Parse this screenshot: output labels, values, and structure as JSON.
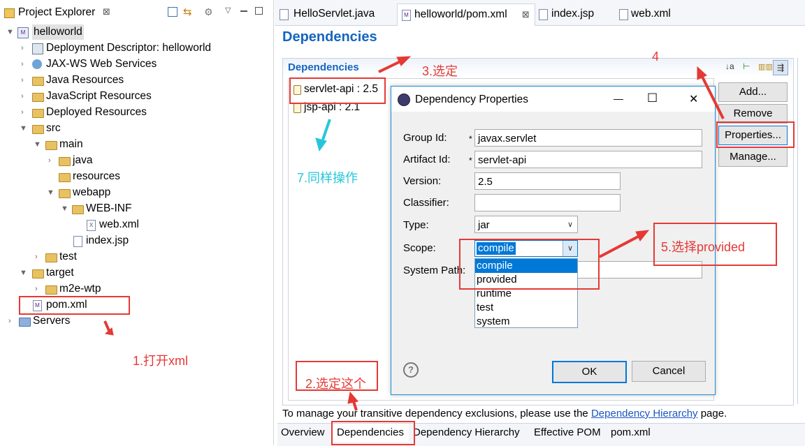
{
  "explorer": {
    "title": "Project Explorer",
    "close_glyph": "⊠",
    "items": [
      {
        "label": "helloworld"
      },
      {
        "label": "Deployment Descriptor: helloworld"
      },
      {
        "label": "JAX-WS Web Services"
      },
      {
        "label": "Java Resources"
      },
      {
        "label": "JavaScript Resources"
      },
      {
        "label": "Deployed Resources"
      },
      {
        "label": "src"
      },
      {
        "label": "main"
      },
      {
        "label": "java"
      },
      {
        "label": "resources"
      },
      {
        "label": "webapp"
      },
      {
        "label": "WEB-INF"
      },
      {
        "label": "web.xml"
      },
      {
        "label": "index.jsp"
      },
      {
        "label": "test"
      },
      {
        "label": "target"
      },
      {
        "label": "m2e-wtp"
      },
      {
        "label": "pom.xml"
      },
      {
        "label": "Servers"
      }
    ]
  },
  "editor": {
    "tabs": [
      {
        "label": "HelloServlet.java"
      },
      {
        "label": "helloworld/pom.xml"
      },
      {
        "label": "index.jsp"
      },
      {
        "label": "web.xml"
      }
    ],
    "tab_close_glyph": "⊠",
    "page_title": "Dependencies",
    "section_title": "Dependencies",
    "dependencies": [
      {
        "label": "servlet-api : 2.5"
      },
      {
        "label": "jsp-api : 2.1"
      }
    ],
    "buttons": {
      "add": "Add...",
      "remove": "Remove",
      "properties": "Properties...",
      "manage": "Manage..."
    },
    "footer_text_before": "To manage your transitive dependency exclusions, please use the",
    "footer_link": "Dependency Hierarchy",
    "footer_text_after": "page.",
    "bottom_tabs": [
      {
        "label": "Overview"
      },
      {
        "label": "Dependencies"
      },
      {
        "label": "Dependency Hierarchy"
      },
      {
        "label": "Effective POM"
      },
      {
        "label": "pom.xml"
      }
    ]
  },
  "dialog": {
    "title": "Dependency Properties",
    "labels": {
      "group_id": "Group Id:",
      "artifact_id": "Artifact Id:",
      "version": "Version:",
      "classifier": "Classifier:",
      "type": "Type:",
      "scope": "Scope:",
      "system_path": "System Path:"
    },
    "required_mark": "*",
    "values": {
      "group_id": "javax.servlet",
      "artifact_id": "servlet-api",
      "version": "2.5",
      "classifier": "",
      "type": "jar",
      "scope": "compile",
      "system_path": ""
    },
    "scope_options": [
      "compile",
      "provided",
      "runtime",
      "test",
      "system"
    ],
    "help_glyph": "?",
    "ok": "OK",
    "cancel": "Cancel",
    "minimize_glyph": "—",
    "maximize_glyph": "☐",
    "close_glyph": "✕"
  },
  "annotations": {
    "step1": "1.打开xml",
    "step2": "2.选定这个",
    "step3": "3.选定",
    "step4": "4",
    "step5": "5.选择provided",
    "step7": "7.同样操作",
    "color": "#e53935",
    "cyan": "#26c6da"
  },
  "colors": {
    "accent": "#1565c0",
    "selection": "#0078d7",
    "link": "#1a56c4"
  }
}
